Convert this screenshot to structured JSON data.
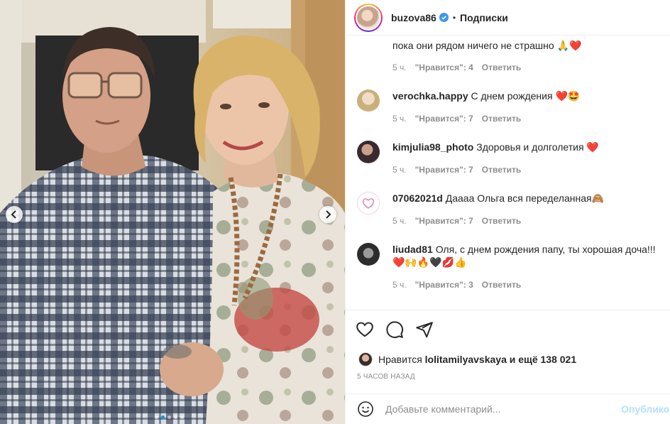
{
  "post": {
    "username": "buzova86",
    "separator": "•",
    "follow_label": "Подписки"
  },
  "comments": [
    {
      "username": "",
      "text": "пока они рядом ничего не страшно 🙏❤️",
      "time": "5 ч.",
      "likes": "\"Нравится\": 4",
      "reply": "Ответить"
    },
    {
      "username": "verochka.happy",
      "text": "С днем рождения ❤️🤩",
      "time": "5 ч.",
      "likes": "\"Нравится\": 7",
      "reply": "Ответить"
    },
    {
      "username": "kimjulia98_photo",
      "text": "Здоровья и долголетия ❤️",
      "time": "5 ч.",
      "likes": "\"Нравится\": 7",
      "reply": "Ответить"
    },
    {
      "username": "07062021d",
      "text": "Даааа Ольга вся переделанная🙈",
      "time": "5 ч.",
      "likes": "\"Нравится\": 7",
      "reply": "Ответить"
    },
    {
      "username": "liudad81",
      "text": "Оля, с днем рождения папу, ты хорошая доча!!!❤️🙌🔥🖤💋👍",
      "time": "5 ч.",
      "likes": "\"Нравится\": 3",
      "reply": "Ответить"
    }
  ],
  "actions": {
    "liked_prefix": "Нравится",
    "liked_user": "lolitamilyavskaya",
    "liked_suffix": "и ещё 138 021",
    "time_ago": "5 ЧАСОВ НАЗАД"
  },
  "comment_box": {
    "placeholder": "Добавьте комментарий...",
    "publish_label": "Опубликовать"
  },
  "carousel": {
    "slide_count": 5,
    "active_index": 1
  },
  "colors": {
    "accent": "#0095f6",
    "verified": "#3897f0",
    "publish_disabled": "#b2dffc",
    "meta_gray": "#8e8e8e"
  },
  "icons": [
    "chevron-left-icon",
    "chevron-right-icon",
    "verified-badge-icon",
    "heart-icon",
    "comment-icon",
    "share-icon",
    "emoji-icon"
  ]
}
